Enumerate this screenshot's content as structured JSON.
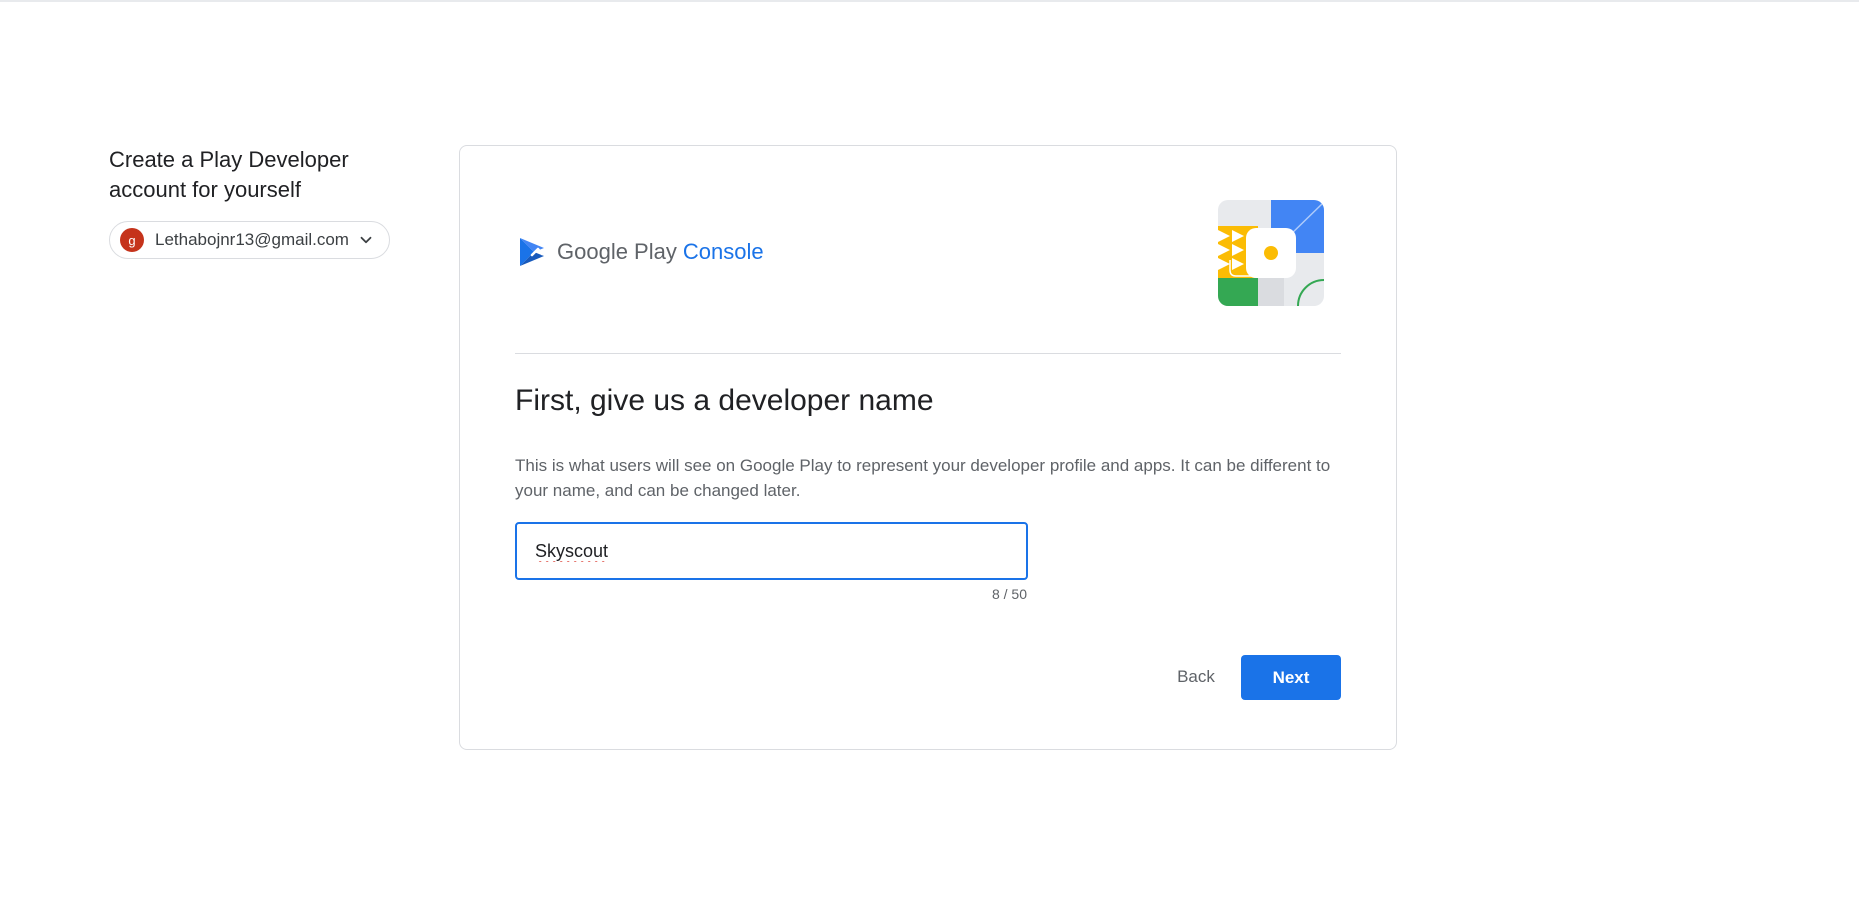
{
  "sidebar": {
    "title": "Create a Play Developer account for yourself",
    "account": {
      "avatar_letter": "g",
      "email": "Lethabojnr13@gmail.com",
      "avatar_color": "#c5331b"
    }
  },
  "card": {
    "brand": {
      "google_play": "Google Play",
      "console": "Console"
    },
    "heading": "First, give us a developer name",
    "description": "This is what users will see on Google Play to represent your developer profile and apps. It can be different to your name, and can be changed later.",
    "developer_name": {
      "value": "Skyscout",
      "counter": "8 / 50"
    },
    "back_label": "Back",
    "next_label": "Next"
  },
  "colors": {
    "accent": "#1a73e8",
    "text_primary": "#202124",
    "text_secondary": "#5f6368",
    "border": "#dadce0"
  },
  "icons": {
    "brand": "google-play-console-logo",
    "illustration": "play-console-illustration",
    "caret": "chevron-down-icon"
  }
}
